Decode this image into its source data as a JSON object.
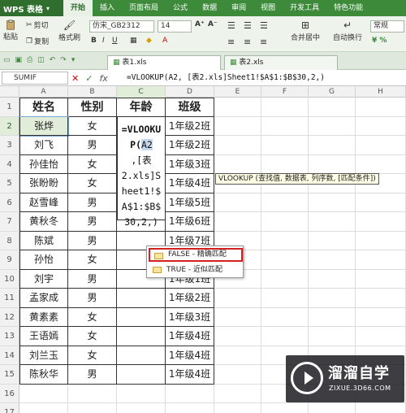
{
  "menubar": {
    "app": "WPS 表格",
    "tabs": [
      "开始",
      "插入",
      "页面布局",
      "公式",
      "数据",
      "审阅",
      "视图",
      "开发工具",
      "特色功能"
    ]
  },
  "ribbon": {
    "paste": "粘贴",
    "cut": "剪切",
    "copy": "复制",
    "format_painter": "格式刷",
    "font_name": "仿宋_GB2312",
    "font_size": "14",
    "merge": "合并居中",
    "wrap": "自动换行",
    "number_format": "常规"
  },
  "doc_tabs": [
    "表1.xls",
    "表2.xls"
  ],
  "formula_bar": {
    "name_box": "SUMIF",
    "formula": "=VLOOKUP(A2, [表2.xls]Sheet1!$A$1:$B$30,2,)"
  },
  "columns": [
    "A",
    "B",
    "C",
    "D",
    "E",
    "F",
    "G",
    "H"
  ],
  "rows": [
    "1",
    "2",
    "3",
    "4",
    "5",
    "6",
    "7",
    "8",
    "9",
    "10",
    "11",
    "12",
    "13",
    "14",
    "15",
    "16",
    "17"
  ],
  "table": {
    "headers": [
      "姓名",
      "性别",
      "年龄",
      "班级"
    ],
    "data": [
      [
        "张烨",
        "女",
        "1年级2班"
      ],
      [
        "刘飞",
        "男",
        "1年级2班"
      ],
      [
        "孙佳怡",
        "女",
        "1年级3班"
      ],
      [
        "张盼盼",
        "女",
        "1年级4班"
      ],
      [
        "赵雪峰",
        "男",
        "1年级5班"
      ],
      [
        "黄秋冬",
        "男",
        "1年级6班"
      ],
      [
        "陈斌",
        "男",
        "1年级7班"
      ],
      [
        "孙怡",
        "女",
        "1年级8班"
      ],
      [
        "刘宇",
        "男",
        "1年级1班"
      ],
      [
        "孟家成",
        "男",
        "1年级2班"
      ],
      [
        "黄素素",
        "女",
        "1年级3班"
      ],
      [
        "王语嫣",
        "女",
        "1年级4班"
      ],
      [
        "刘兰玉",
        "女",
        "1年级4班"
      ],
      [
        "陈秋华",
        "男",
        "1年级4班"
      ]
    ]
  },
  "edit_cell_lines": [
    "=VLOOKU",
    "P(",
    "A2",
    ",[表",
    "2.xls]S",
    "heet1!$",
    "A$1:$B$",
    "30,2,)"
  ],
  "tooltip": "VLOOKUP (查找值, 数据表, 列序数, [匹配条件])",
  "dropdown": [
    "FALSE - 精确匹配",
    "TRUE - 近似匹配"
  ],
  "watermark": {
    "name": "溜溜自学",
    "url": "ZIXUE.3D66.COM"
  }
}
